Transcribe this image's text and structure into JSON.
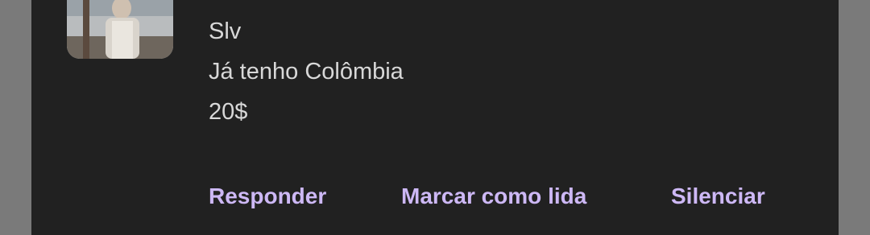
{
  "notification": {
    "sender": "Slv",
    "lines": [
      "Já tenho Colômbia",
      "20$"
    ],
    "actions": {
      "reply": "Responder",
      "mark_read": "Marcar como lida",
      "mute": "Silenciar"
    }
  },
  "colors": {
    "card_background": "#212121",
    "text": "#d8d8d8",
    "action_text": "#cdb8f5",
    "backdrop": "#7a7a7a"
  }
}
